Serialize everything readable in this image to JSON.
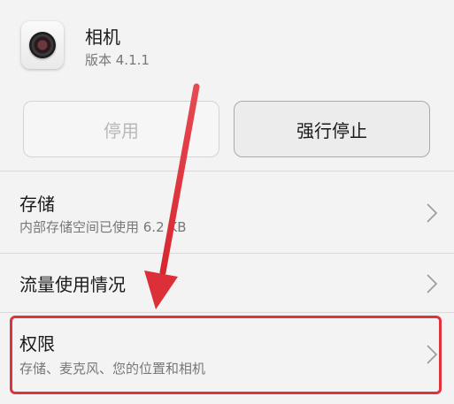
{
  "app": {
    "name": "相机",
    "version": "版本 4.1.1",
    "icon": "camera-icon"
  },
  "actions": {
    "disable_label": "停用",
    "force_stop_label": "强行停止"
  },
  "settings": {
    "storage": {
      "title": "存储",
      "subtitle": "内部存储空间已使用 6.2 KB"
    },
    "data_usage": {
      "title": "流量使用情况"
    },
    "permissions": {
      "title": "权限",
      "subtitle": "存储、麦克风、您的位置和相机"
    }
  },
  "annotation": {
    "color": "#e0323b",
    "arrow_icon": "red-arrow-icon"
  }
}
